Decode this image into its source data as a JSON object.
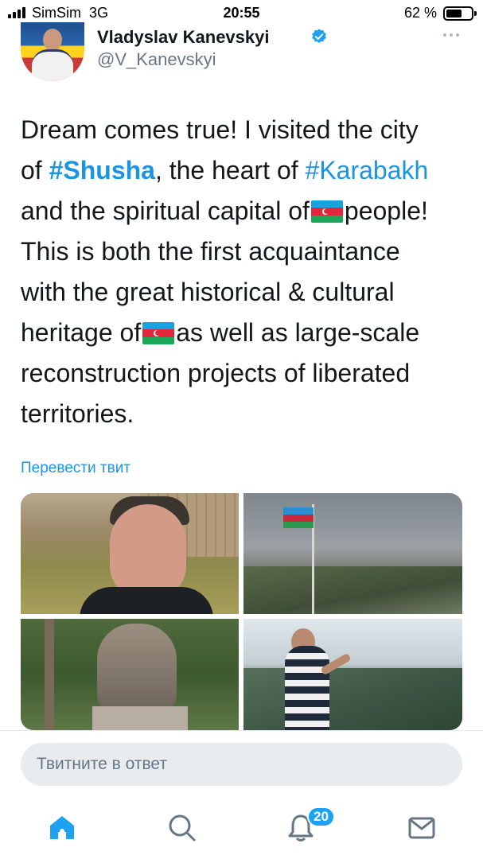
{
  "status_bar": {
    "carrier": "SimSim",
    "network": "3G",
    "time": "20:55",
    "battery": "62 %",
    "battery_level": 0.62
  },
  "tweet": {
    "author": {
      "name": "Vladyslav Kanevskyi",
      "handle": "@V_Kanevskyi",
      "verified": true
    },
    "lines": {
      "l1": "Dream comes true! I visited the city",
      "l2_pre": "of ",
      "l2_tag1": "#Shusha",
      "l2_mid": ", the heart of ",
      "l2_tag2": "#Karabakh",
      "l3_pre": "and the spiritual capital of",
      "l3_post": "people!",
      "l4": "This is both the first acquaintance",
      "l5": "with the great historical & cultural",
      "l6_pre": "heritage of",
      "l6_post": "as well as large-scale",
      "l7": "reconstruction projects of liberated",
      "l8": "territories."
    },
    "flag_emoji": "azerbaijan-flag",
    "translate_link": "Перевести твит",
    "photos": [
      "selfie-at-fortress",
      "flag-over-hills",
      "bust-in-park",
      "man-photographing-mountains"
    ]
  },
  "reply": {
    "placeholder": "Твитните в ответ"
  },
  "nav": {
    "items": [
      "home-icon",
      "search-icon",
      "notifications-icon",
      "messages-icon"
    ],
    "notifications_badge": "20"
  },
  "colors": {
    "accent": "#1da1f2",
    "link": "#1b95e0",
    "text": "#14171a",
    "secondary": "#657786"
  }
}
